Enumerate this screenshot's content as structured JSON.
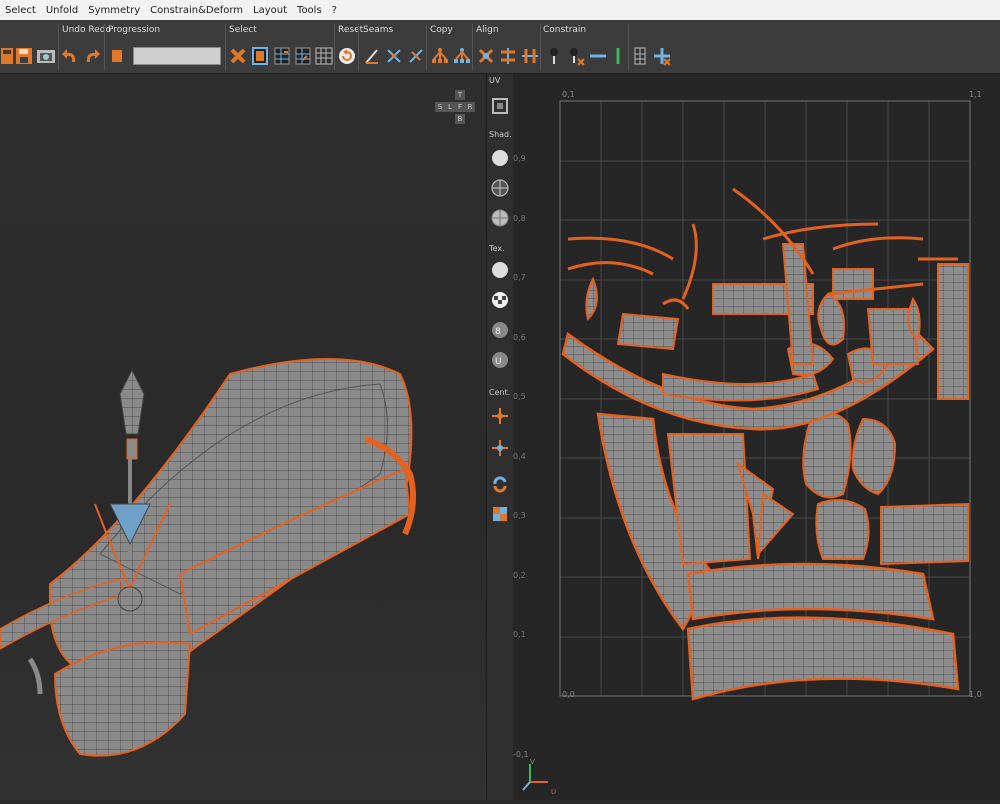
{
  "menu": [
    "Select",
    "Unfold",
    "Symmetry",
    "Constrain&Deform",
    "Layout",
    "Tools",
    "?"
  ],
  "toolbar": {
    "groups": {
      "undo_redo": "Undo Redo",
      "progression": "Progression",
      "select": "Select",
      "reset": "Reset",
      "seams": "Seams",
      "copy": "Copy",
      "align": "Align",
      "constrain": "Constrain"
    }
  },
  "side_panel": {
    "uv": "UV",
    "shading": "Shad.",
    "texture": "Tex.",
    "center": "Cent."
  },
  "view_cube": {
    "top": "T",
    "left": "L",
    "front": "F",
    "right": "R",
    "back": "B",
    "bottom": "B",
    "s": "S"
  },
  "uv_grid": {
    "corner_tl": "0,1",
    "corner_tr": "1,1",
    "corner_bl": "0,0",
    "corner_br": "1,0",
    "y_ticks": [
      "0,9",
      "0,8",
      "0,7",
      "0,6",
      "0,5",
      "0,4",
      "0,3",
      "0,2",
      "0,1"
    ],
    "below": "-0,1",
    "axis_v": "V",
    "axis_u": "U"
  },
  "colors": {
    "accent": "#e4611f",
    "mesh": "#8d8d8d",
    "grid": "#4a4a4a",
    "uv_bg": "#262626",
    "icon_orange": "#e0782a",
    "icon_blue": "#6fb2e6"
  }
}
